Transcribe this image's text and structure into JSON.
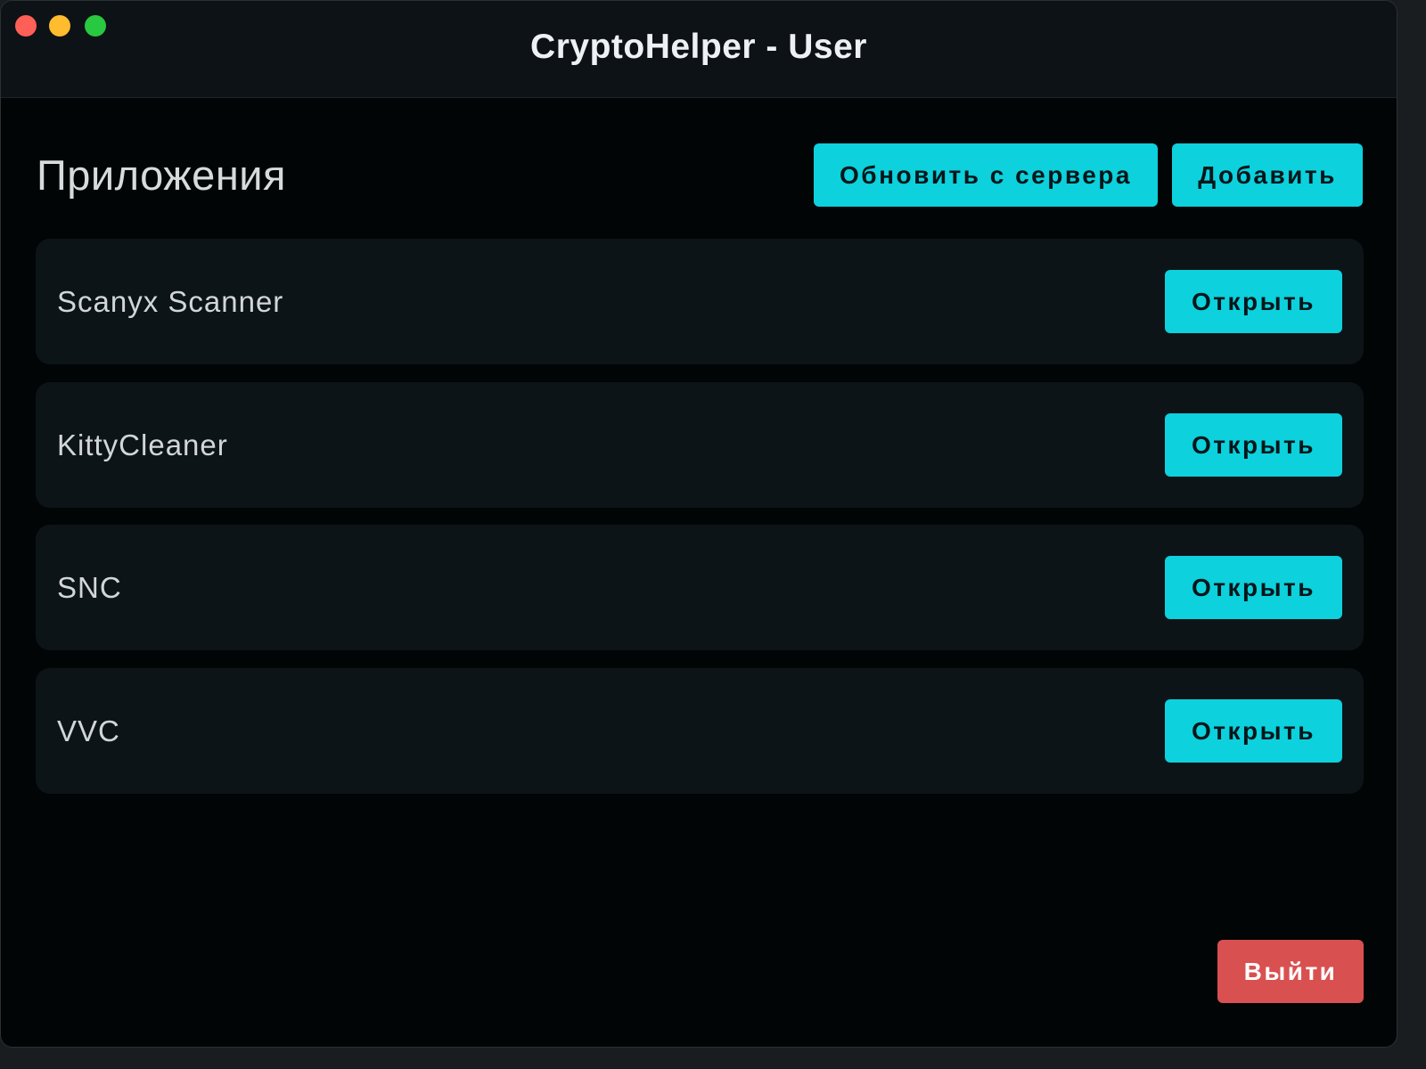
{
  "window": {
    "title": "CryptoHelper - User"
  },
  "main": {
    "section_title": "Приложения",
    "refresh_label": "Обновить с сервера",
    "add_label": "Добавить",
    "apps": [
      {
        "name": "Scanyx Scanner",
        "open_label": "Открыть"
      },
      {
        "name": "KittyCleaner",
        "open_label": "Открыть"
      },
      {
        "name": "SNC",
        "open_label": "Открыть"
      },
      {
        "name": "VVC",
        "open_label": "Открыть"
      }
    ],
    "logout_label": "Выйти"
  },
  "colors": {
    "accent": "#0dd1dc",
    "danger": "#d95050",
    "background": "#010506",
    "card": "#0d1418"
  }
}
